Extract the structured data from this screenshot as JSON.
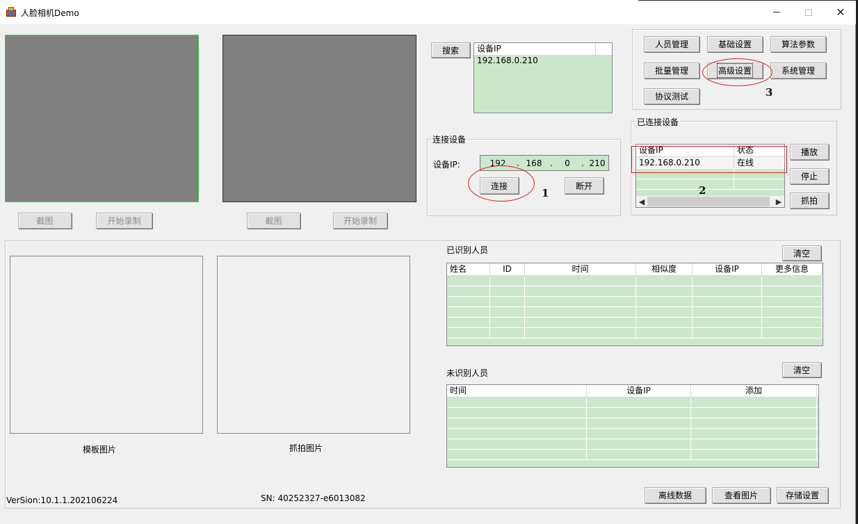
{
  "window": {
    "title": "人脸相机Demo"
  },
  "video": {
    "left_screenshot": "截图",
    "left_record": "开始录制",
    "right_screenshot": "截图",
    "right_record": "开始录制"
  },
  "search": {
    "button": "搜索",
    "column": "设备IP",
    "results": [
      "192.168.0.210"
    ]
  },
  "connect": {
    "group_title": "连接设备",
    "ip_label": "设备IP:",
    "ip_octets": [
      "192",
      "168",
      "0",
      "210"
    ],
    "ip_dots": [
      ".",
      ".",
      "."
    ],
    "connect_button": "连接",
    "disconnect_button": "断开"
  },
  "top_buttons": {
    "person": "人员管理",
    "basic": "基础设置",
    "algo": "算法参数",
    "batch": "批量管理",
    "advanced": "高级设置",
    "system": "系统管理",
    "protocol": "协议测试"
  },
  "connected": {
    "group_title": "已连接设备",
    "columns": [
      "设备IP",
      "状态"
    ],
    "rows": [
      [
        "192.168.0.210",
        "在线"
      ]
    ],
    "play": "播放",
    "stop": "停止",
    "capture": "抓拍"
  },
  "annotations": {
    "n1": "1",
    "n2": "2",
    "n3": "3"
  },
  "images": {
    "template_label": "模板图片",
    "capture_label": "抓拍图片"
  },
  "recognized": {
    "title": "已识别人员",
    "clear": "清空",
    "columns": [
      "姓名",
      "ID",
      "时间",
      "相似度",
      "设备IP",
      "更多信息"
    ]
  },
  "unrecognized": {
    "title": "未识别人员",
    "clear": "清空",
    "columns": [
      "时间",
      "设备IP",
      "添加"
    ]
  },
  "footer": {
    "version": "VerSion:10.1.1.202106224",
    "sn": "SN: 40252327-e6013082",
    "offline": "离线数据",
    "view_images": "查看图片",
    "storage": "存储设置"
  },
  "colors": {
    "list_bg": "#cce8cc",
    "video_bg": "#808080",
    "active_border": "#3ad23a",
    "annotation": "#e21b1b"
  }
}
